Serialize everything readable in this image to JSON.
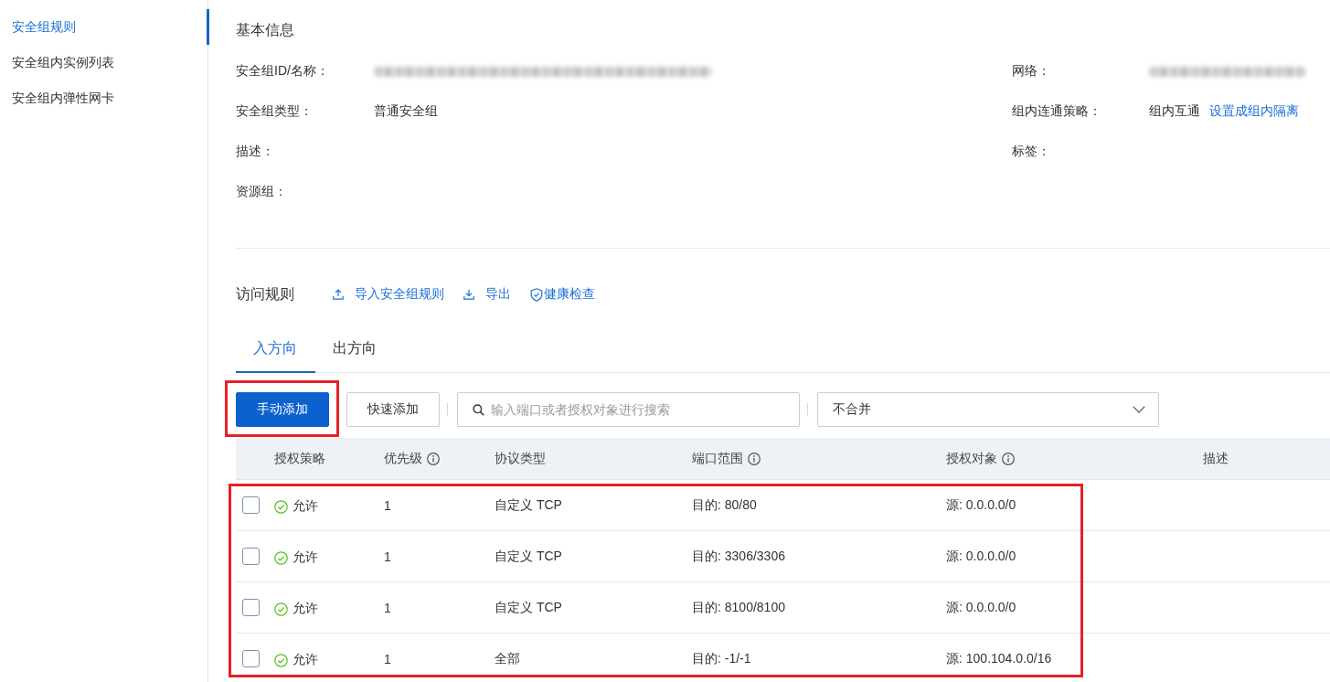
{
  "sidebar": {
    "items": [
      {
        "label": "安全组规则",
        "selected": true
      },
      {
        "label": "安全组内实例列表",
        "selected": false
      },
      {
        "label": "安全组内弹性网卡",
        "selected": false
      }
    ]
  },
  "basic_info": {
    "title": "基本信息",
    "fields": [
      {
        "label": "安全组ID/名称：",
        "value_blurred": true
      },
      {
        "label": "网络：",
        "value_blurred": true
      },
      {
        "label": "安全组类型：",
        "value": "普通安全组"
      },
      {
        "label": "组内连通策略：",
        "value": "组内互通",
        "link": "设置成组内隔离"
      },
      {
        "label": "描述："
      },
      {
        "label": "标签："
      },
      {
        "label": "资源组："
      }
    ]
  },
  "access_rules": {
    "title": "访问规则",
    "actions": [
      {
        "kind": "upload",
        "label": "导入安全组规则"
      },
      {
        "kind": "download",
        "label": "导出"
      },
      {
        "kind": "shield",
        "label": "健康检查"
      }
    ],
    "tabs": [
      {
        "label": "入方向",
        "selected": true
      },
      {
        "label": "出方向",
        "selected": false
      }
    ],
    "buttons": [
      {
        "label": "手动添加",
        "primary": true,
        "highlighted": true
      },
      {
        "label": "快速添加",
        "primary": false,
        "highlighted": false
      }
    ],
    "search": {
      "placeholder": "输入端口或者授权对象进行搜索"
    },
    "merge_select": {
      "value": "不合并"
    },
    "table": {
      "columns": [
        {
          "label": "授权策略",
          "info": false
        },
        {
          "label": "优先级",
          "info": true
        },
        {
          "label": "协议类型",
          "info": false
        },
        {
          "label": "端口范围",
          "info": true
        },
        {
          "label": "授权对象",
          "info": true
        },
        {
          "label": "描述",
          "info": false
        }
      ],
      "rows_highlighted": true,
      "rows": [
        {
          "checked": false,
          "policy": "允许",
          "priority": "1",
          "protocol": "自定义 TCP",
          "port_range": "目的: 80/80",
          "source": "源: 0.0.0.0/0"
        },
        {
          "checked": false,
          "policy": "允许",
          "priority": "1",
          "protocol": "自定义 TCP",
          "port_range": "目的: 3306/3306",
          "source": "源: 0.0.0.0/0"
        },
        {
          "checked": false,
          "policy": "允许",
          "priority": "1",
          "protocol": "自定义 TCP",
          "port_range": "目的: 8100/8100",
          "source": "源: 0.0.0.0/0"
        },
        {
          "checked": false,
          "policy": "允许",
          "priority": "1",
          "protocol": "全部",
          "port_range": "目的: -1/-1",
          "source": "源: 100.104.0.0/16"
        }
      ]
    }
  }
}
